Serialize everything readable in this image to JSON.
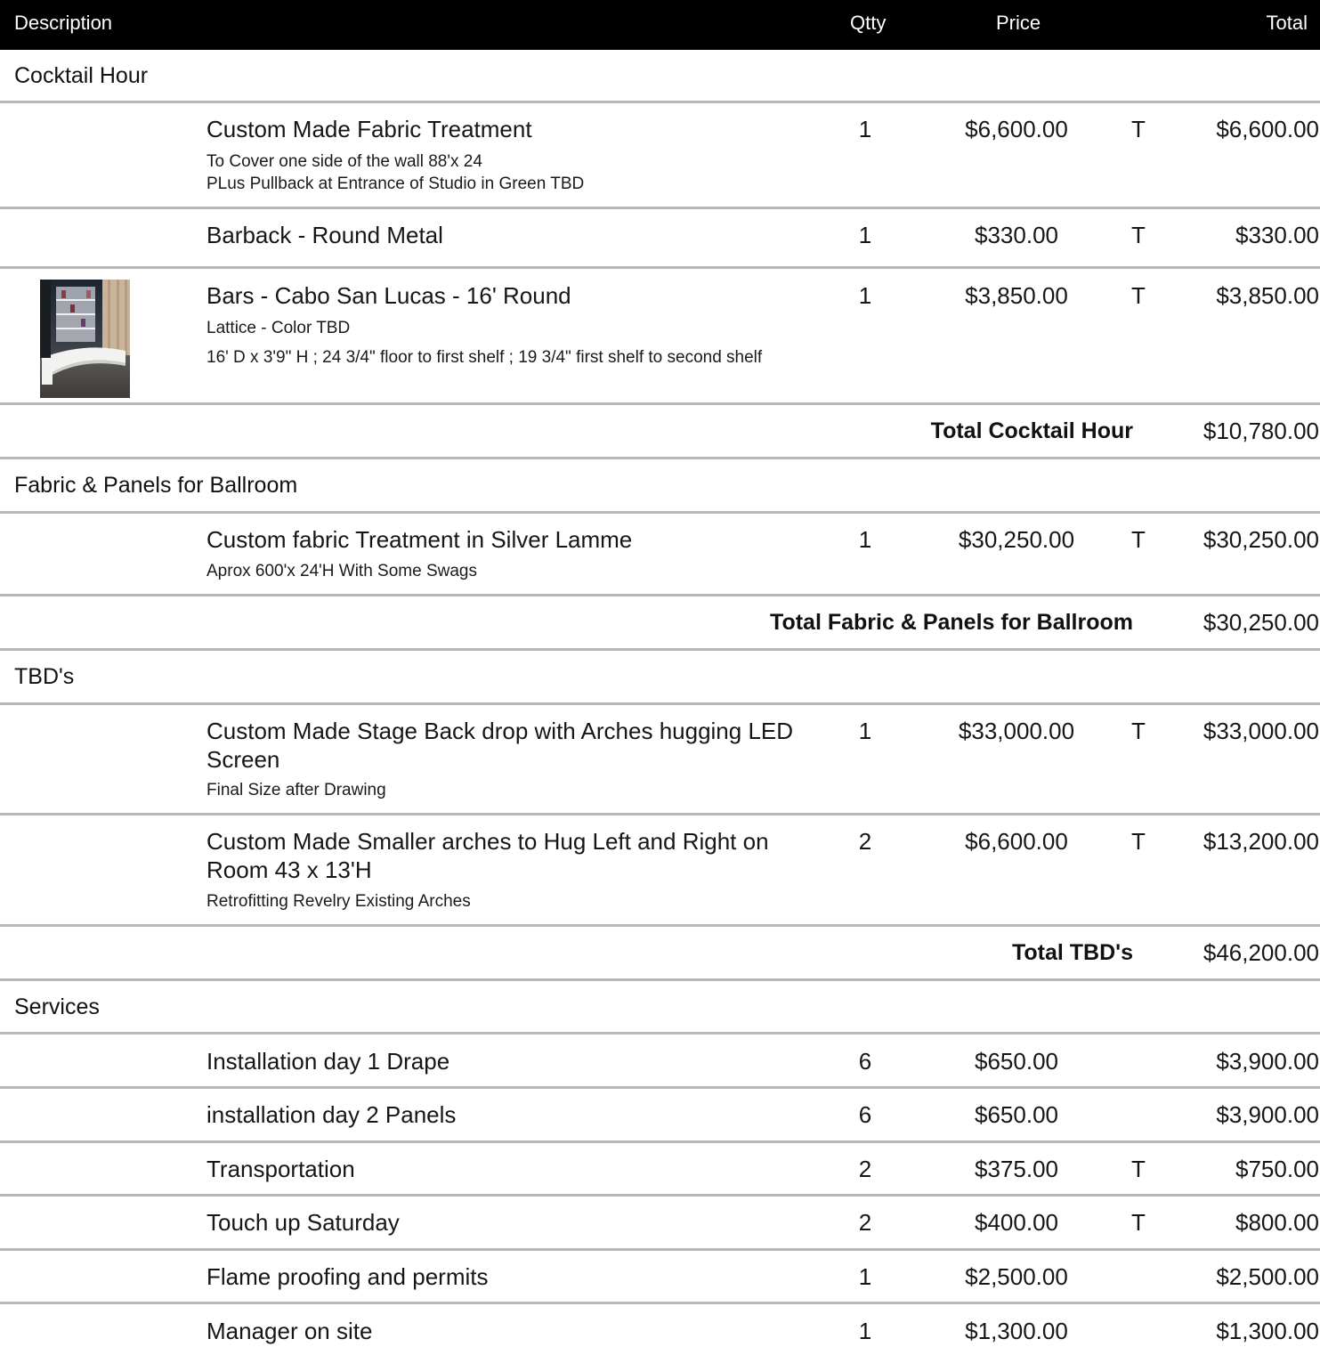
{
  "header": {
    "description": "Description",
    "qty": "Qtty",
    "price": "Price",
    "total": "Total"
  },
  "sections": [
    {
      "title": "Cocktail Hour",
      "items": [
        {
          "name": "Custom Made Fabric Treatment",
          "notes": [
            "To Cover one side of the wall 88'x 24",
            "PLus Pullback at Entrance of Studio in Green TBD"
          ],
          "qty": "1",
          "price": "$6,600.00",
          "tax": "T",
          "total": "$6,600.00"
        },
        {
          "name": "Barback - Round Metal",
          "notes": [],
          "qty": "1",
          "price": "$330.00",
          "tax": "T",
          "total": "$330.00"
        },
        {
          "name": "Bars - Cabo San Lucas - 16' Round",
          "notes": [
            "Lattice - Color TBD",
            "16' D x 3'9\" H ; 24 3/4\" floor to first shelf ; 19 3/4\" first shelf to second shelf"
          ],
          "qty": "1",
          "price": "$3,850.00",
          "tax": "T",
          "total": "$3,850.00",
          "has_image": true
        }
      ],
      "subtotal_label": "Total Cocktail Hour",
      "subtotal": "$10,780.00"
    },
    {
      "title": "Fabric & Panels for Ballroom",
      "items": [
        {
          "name": "Custom fabric Treatment in Silver Lamme",
          "notes": [
            "Aprox 600'x 24'H With Some Swags"
          ],
          "qty": "1",
          "price": "$30,250.00",
          "tax": "T",
          "total": "$30,250.00"
        }
      ],
      "subtotal_label": "Total Fabric & Panels for Ballroom",
      "subtotal": "$30,250.00"
    },
    {
      "title": "TBD's",
      "items": [
        {
          "name": "Custom Made Stage Back drop with Arches hugging LED Screen",
          "notes": [
            "Final Size after Drawing"
          ],
          "qty": "1",
          "price": "$33,000.00",
          "tax": "T",
          "total": "$33,000.00"
        },
        {
          "name": "Custom Made Smaller arches to Hug Left and Right on Room  43 x 13'H",
          "notes": [
            "Retrofitting Revelry Existing Arches"
          ],
          "qty": "2",
          "price": "$6,600.00",
          "tax": "T",
          "total": "$13,200.00"
        }
      ],
      "subtotal_label": "Total TBD's",
      "subtotal": "$46,200.00"
    },
    {
      "title": "Services",
      "items": [
        {
          "name": "Installation day 1 Drape",
          "notes": [],
          "qty": "6",
          "price": "$650.00",
          "tax": "",
          "total": "$3,900.00"
        },
        {
          "name": "installation day 2 Panels",
          "notes": [],
          "qty": "6",
          "price": "$650.00",
          "tax": "",
          "total": "$3,900.00"
        },
        {
          "name": "Transportation",
          "notes": [],
          "qty": "2",
          "price": "$375.00",
          "tax": "T",
          "total": "$750.00"
        },
        {
          "name": "Touch up Saturday",
          "notes": [],
          "qty": "2",
          "price": "$400.00",
          "tax": "T",
          "total": "$800.00"
        },
        {
          "name": "Flame proofing and permits",
          "notes": [],
          "qty": "1",
          "price": "$2,500.00",
          "tax": "",
          "total": "$2,500.00"
        },
        {
          "name": "Manager on site",
          "notes": [],
          "qty": "1",
          "price": "$1,300.00",
          "tax": "",
          "total": "$1,300.00"
        }
      ]
    }
  ]
}
